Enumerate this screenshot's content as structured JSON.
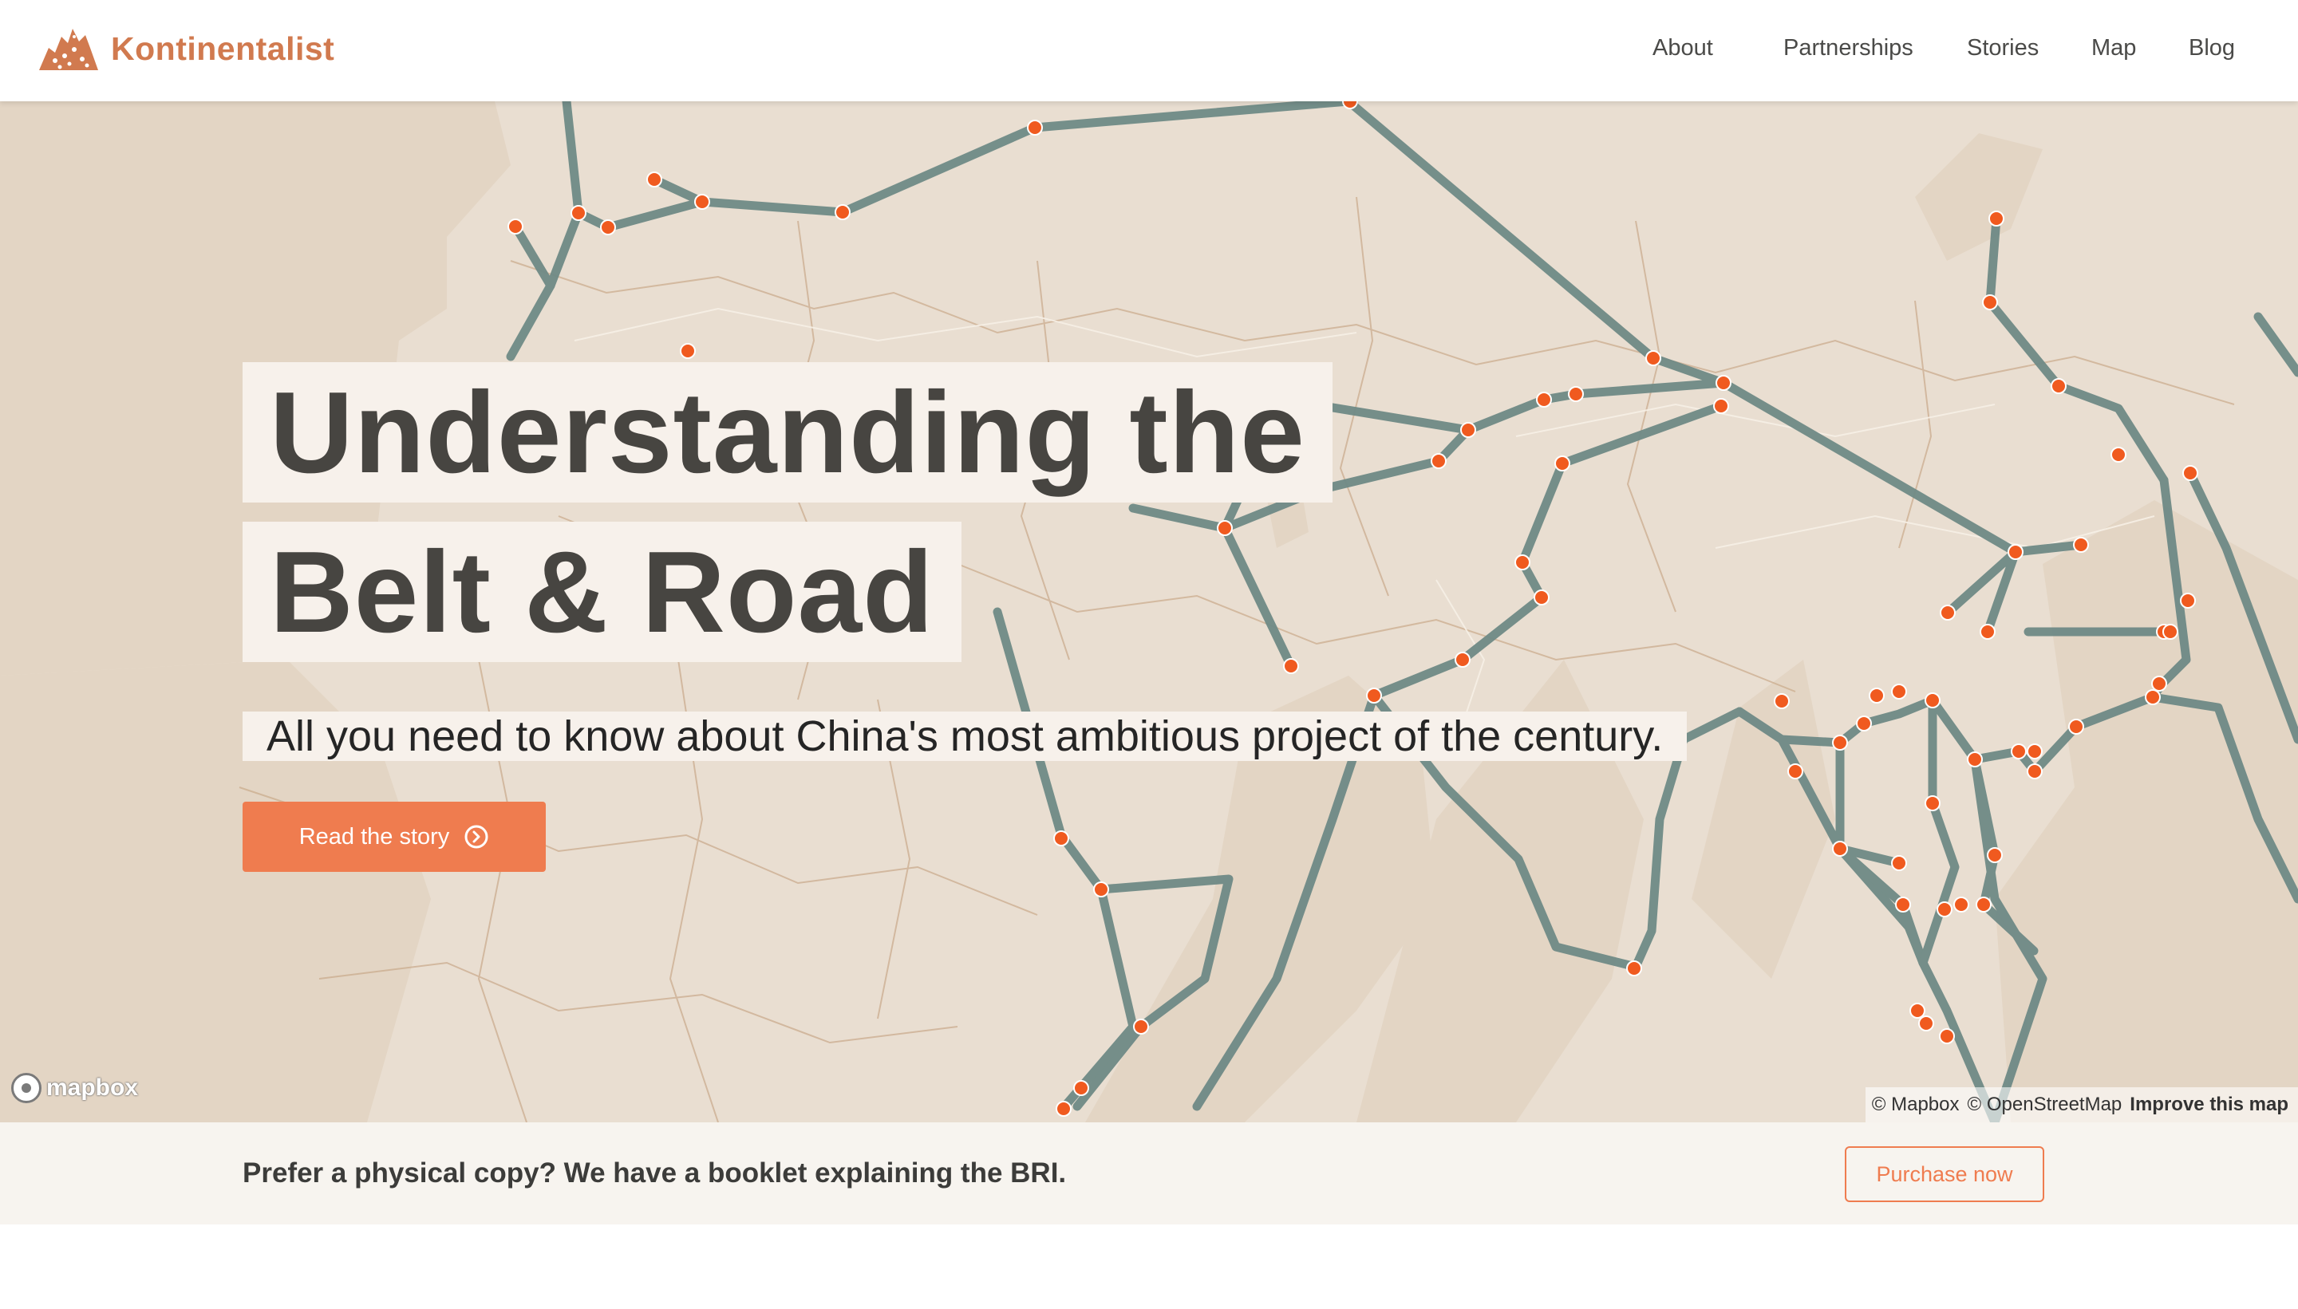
{
  "site": {
    "brand_name": "Kontinentalist",
    "logo_icon": "kontinentalist-logo-icon"
  },
  "nav": {
    "items": [
      {
        "label": "About"
      },
      {
        "label": "Partnerships"
      },
      {
        "label": "Stories"
      },
      {
        "label": "Map"
      },
      {
        "label": "Blog"
      }
    ]
  },
  "hero": {
    "title_line1": "Understanding the",
    "title_line2": "Belt & Road",
    "subtitle": "All you need to know about China's most ambitious project of the century.",
    "cta_label": "Read the story",
    "cta_icon": "circle-chevron-right-icon"
  },
  "map": {
    "logo_text": "mapbox",
    "attribution_mapbox": "© Mapbox",
    "attribution_osm": "© OpenStreetMap",
    "improve_link": "Improve this map",
    "route_color": "#6f8a86",
    "node_color": "#f05a1f",
    "land_color": "#e9ded1"
  },
  "booklet": {
    "text": "Prefer a physical copy? We have a booklet explaining the BRI.",
    "button_label": "Purchase now"
  },
  "colors": {
    "brand": "#d17a4f",
    "accent": "#ef7c4f",
    "title_box": "#f7f1eb",
    "strip": "#f7f4ef"
  }
}
